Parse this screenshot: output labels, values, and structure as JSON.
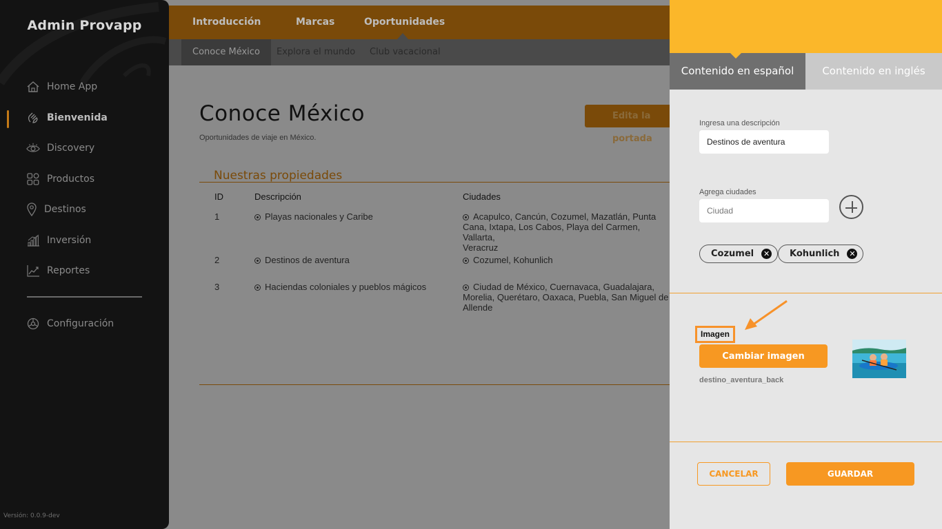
{
  "sidebar": {
    "brand": "Admin Provapp",
    "items": [
      {
        "label": "Home App",
        "icon": "home-icon"
      },
      {
        "label": "Bienvenida",
        "icon": "wave-icon"
      },
      {
        "label": "Discovery",
        "icon": "eye-icon"
      },
      {
        "label": "Productos",
        "icon": "grid-icon"
      },
      {
        "label": "Destinos",
        "icon": "location-icon"
      },
      {
        "label": "Inversión",
        "icon": "bar-chart-icon"
      },
      {
        "label": "Reportes",
        "icon": "line-chart-icon"
      },
      {
        "label": "Configuración",
        "icon": "gear-icon"
      }
    ],
    "active_index": 1,
    "version": "Versión: 0.0.9-dev"
  },
  "topnav": {
    "tabs": [
      "Introducción",
      "Marcas",
      "Oportunidades"
    ],
    "active_index": 2
  },
  "subnav": {
    "tabs": [
      "Conoce México",
      "Explora el mundo",
      "Club vacacional"
    ],
    "active_index": 0
  },
  "main": {
    "title": "Conoce México",
    "subtitle": "Oportunidades de viaje en México.",
    "edit_button": "Edita la portada",
    "section_title": "Nuestras propiedades",
    "table": {
      "headers": [
        "ID",
        "Descripción",
        "Ciudades"
      ],
      "rows": [
        {
          "id": "1",
          "description": "Playas nacionales y Caribe",
          "cities_line1": "Acapulco, Cancún, Cozumel, Mazatlán, Punta",
          "cities_line2": "Cana, Ixtapa, Los Cabos, Playa del Carmen, Vallarta,",
          "cities_line3": "Veracruz"
        },
        {
          "id": "2",
          "description": "Destinos de aventura",
          "cities_line1": "Cozumel, Kohunlich",
          "cities_line2": "",
          "cities_line3": ""
        },
        {
          "id": "3",
          "description": "Haciendas coloniales y pueblos mágicos",
          "cities_line1": "Ciudad de México, Cuernavaca, Guadalajara,",
          "cities_line2": "Morelia, Querétaro, Oaxaca, Puebla, San Miguel de",
          "cities_line3": "Allende"
        }
      ]
    }
  },
  "panel": {
    "tab_es": "Contenido en español",
    "tab_en": "Contenido en inglés",
    "desc_label": "Ingresa una descripción",
    "desc_value": "Destinos de aventura",
    "cities_label": "Agrega ciudades",
    "cities_placeholder": "Ciudad",
    "chips": [
      "Cozumel",
      "Kohunlich"
    ],
    "chip_remove_glyph": "✕",
    "image_label": "Imagen",
    "change_image_button": "Cambiar imagen",
    "filename": "destino_aventura_back",
    "cancel_button": "CANCELAR",
    "save_button": "GUARDAR",
    "colors": {
      "header": "#fbb72a",
      "accent": "#f79822",
      "tab_active": "#6f6f6f",
      "tab_inactive": "#c9c9c9"
    }
  }
}
